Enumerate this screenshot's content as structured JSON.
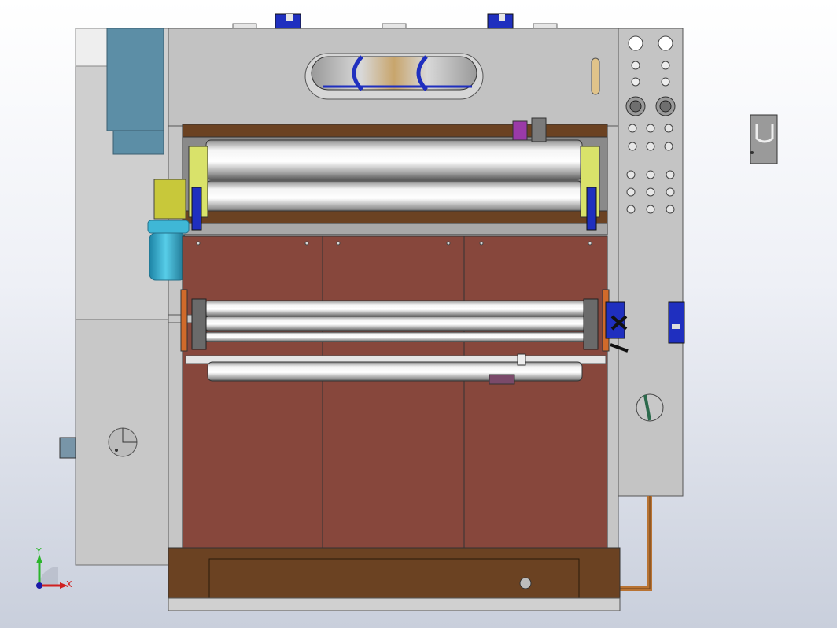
{
  "viewport": {
    "background_top": "#ffffff",
    "background_bottom": "#c9cfdc"
  },
  "triad": {
    "y_label": "Y",
    "x_label": "X",
    "y_color": "#2bb52b",
    "x_color": "#d02020",
    "origin_color": "#1a1aa8"
  },
  "colors": {
    "frame": "#c4c4c4",
    "frame_dark": "#9a9a9a",
    "rust_panel": "#87473c",
    "wood_base": "#6b4222",
    "motor_cyan": "#3fb7d6",
    "gearbox_yellow": "#c8c83a",
    "accent_blue": "#1f2fbf",
    "steel_blue": "#5a8ea8",
    "copper": "#b87333"
  },
  "parts": {
    "top_rollers": 2,
    "middle_rollers": 3,
    "bottom_roller": 1,
    "front_panels": 3,
    "side_holes_rows": 3
  }
}
